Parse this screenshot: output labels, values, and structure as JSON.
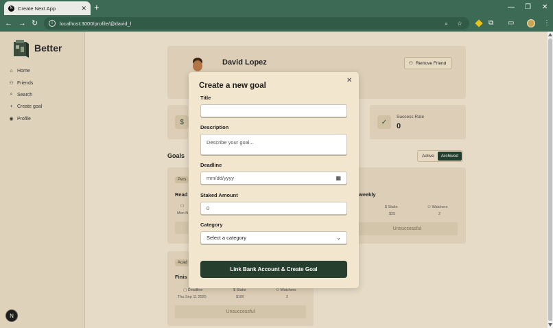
{
  "browser": {
    "tab_title": "Create Next App",
    "tab_favicon": "N",
    "url": "localhost:3000/profile/@david_l"
  },
  "sidebar": {
    "brand": "Better",
    "items": [
      {
        "label": "Home",
        "icon": "home-icon"
      },
      {
        "label": "Friends",
        "icon": "users-icon"
      },
      {
        "label": "Search",
        "icon": "search-icon"
      },
      {
        "label": "Create goal",
        "icon": "plus-icon"
      },
      {
        "label": "Profile",
        "icon": "profile-icon"
      }
    ],
    "badge": "N"
  },
  "profile": {
    "name": "David Lopez",
    "remove_friend": "Remove Friend"
  },
  "stats": {
    "success_rate_label": "Success Rate",
    "success_rate_value": "0"
  },
  "goals": {
    "title": "Goals",
    "tabs": [
      "Active",
      "Archived"
    ],
    "active_tab": "Archived",
    "cards": [
      {
        "chip": "Pers",
        "title": "Read",
        "meta_date": "Mon N"
      },
      {
        "title": "weekly",
        "stake_label": "Stake",
        "stake": "$25",
        "watchers_label": "Watchers",
        "watchers": "2",
        "status": "Unsuccessful"
      },
      {
        "chip": "Acad",
        "title": "Finis",
        "deadline_label": "Deadline",
        "deadline": "Thu Sep 11 2025",
        "stake_label": "Stake",
        "stake": "$100",
        "watchers_label": "Watchers",
        "watchers": "2",
        "status": "Unsuccessful"
      }
    ]
  },
  "modal": {
    "title": "Create a new goal",
    "title_label": "Title",
    "title_value": "",
    "description_label": "Description",
    "description_placeholder": "Describe your goal...",
    "deadline_label": "Deadline",
    "deadline_placeholder": "mm/dd/yyyy",
    "staked_label": "Staked Amount",
    "staked_value": "0",
    "category_label": "Category",
    "category_selected": "Select a category",
    "submit_label": "Link Bank Account & Create Goal"
  },
  "colors": {
    "chrome": "#3d6a55",
    "accent_dark_green": "#253e2d",
    "page_bg": "#efe4d0",
    "modal_bg": "#f3e6cf"
  }
}
